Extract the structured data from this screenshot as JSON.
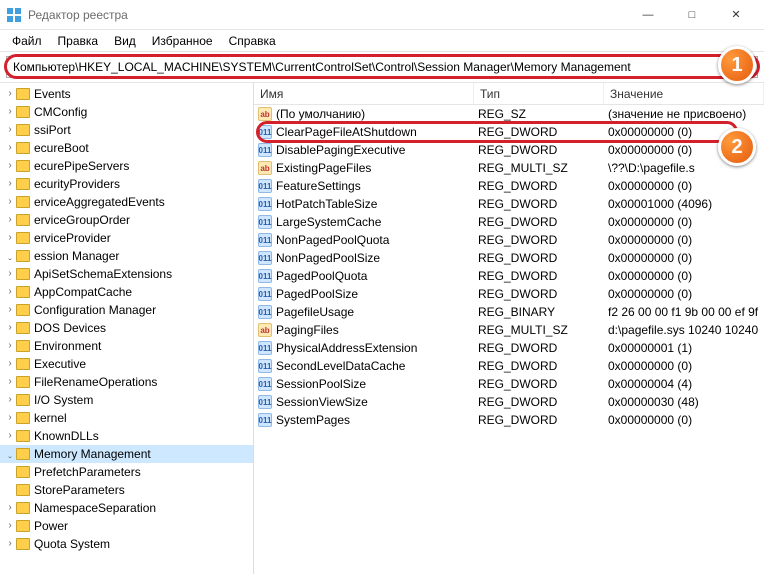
{
  "window": {
    "title": "Редактор реестра",
    "min": "—",
    "max": "□",
    "close": "✕"
  },
  "menu": {
    "file": "Файл",
    "edit": "Правка",
    "view": "Вид",
    "favorites": "Избранное",
    "help": "Справка"
  },
  "address": "Компьютер\\HKEY_LOCAL_MACHINE\\SYSTEM\\CurrentControlSet\\Control\\Session Manager\\Memory Management",
  "columns": {
    "name": "Имя",
    "type": "Тип",
    "value": "Значение"
  },
  "tree": [
    {
      "label": "Events",
      "indent": 1
    },
    {
      "label": "CMConfig",
      "indent": 1
    },
    {
      "label": "ssiPort",
      "indent": 1
    },
    {
      "label": "ecureBoot",
      "indent": 1
    },
    {
      "label": "ecurePipeServers",
      "indent": 1
    },
    {
      "label": "ecurityProviders",
      "indent": 1
    },
    {
      "label": "erviceAggregatedEvents",
      "indent": 1
    },
    {
      "label": "erviceGroupOrder",
      "indent": 1
    },
    {
      "label": "erviceProvider",
      "indent": 1
    },
    {
      "label": "ession Manager",
      "indent": 1,
      "expanded": true
    },
    {
      "label": "ApiSetSchemaExtensions",
      "indent": 2
    },
    {
      "label": "AppCompatCache",
      "indent": 2
    },
    {
      "label": "Configuration Manager",
      "indent": 2
    },
    {
      "label": "DOS Devices",
      "indent": 2
    },
    {
      "label": "Environment",
      "indent": 2
    },
    {
      "label": "Executive",
      "indent": 2
    },
    {
      "label": "FileRenameOperations",
      "indent": 2
    },
    {
      "label": "I/O System",
      "indent": 2
    },
    {
      "label": "kernel",
      "indent": 2
    },
    {
      "label": "KnownDLLs",
      "indent": 2
    },
    {
      "label": "Memory Management",
      "indent": 2,
      "selected": true,
      "expanded": true
    },
    {
      "label": "PrefetchParameters",
      "indent": 3
    },
    {
      "label": "StoreParameters",
      "indent": 3
    },
    {
      "label": "NamespaceSeparation",
      "indent": 2
    },
    {
      "label": "Power",
      "indent": 2
    },
    {
      "label": "Quota System",
      "indent": 2
    }
  ],
  "values": [
    {
      "icon": "str",
      "name": "(По умолчанию)",
      "type": "REG_SZ",
      "value": "(значение не присвоено)"
    },
    {
      "icon": "bin",
      "name": "ClearPageFileAtShutdown",
      "type": "REG_DWORD",
      "value": "0x00000000 (0)",
      "highlighted": true
    },
    {
      "icon": "bin",
      "name": "DisablePagingExecutive",
      "type": "REG_DWORD",
      "value": "0x00000000 (0)"
    },
    {
      "icon": "str",
      "name": "ExistingPageFiles",
      "type": "REG_MULTI_SZ",
      "value": "\\??\\D:\\pagefile.s"
    },
    {
      "icon": "bin",
      "name": "FeatureSettings",
      "type": "REG_DWORD",
      "value": "0x00000000 (0)"
    },
    {
      "icon": "bin",
      "name": "HotPatchTableSize",
      "type": "REG_DWORD",
      "value": "0x00001000 (4096)"
    },
    {
      "icon": "bin",
      "name": "LargeSystemCache",
      "type": "REG_DWORD",
      "value": "0x00000000 (0)"
    },
    {
      "icon": "bin",
      "name": "NonPagedPoolQuota",
      "type": "REG_DWORD",
      "value": "0x00000000 (0)"
    },
    {
      "icon": "bin",
      "name": "NonPagedPoolSize",
      "type": "REG_DWORD",
      "value": "0x00000000 (0)"
    },
    {
      "icon": "bin",
      "name": "PagedPoolQuota",
      "type": "REG_DWORD",
      "value": "0x00000000 (0)"
    },
    {
      "icon": "bin",
      "name": "PagedPoolSize",
      "type": "REG_DWORD",
      "value": "0x00000000 (0)"
    },
    {
      "icon": "bin",
      "name": "PagefileUsage",
      "type": "REG_BINARY",
      "value": "f2 26 00 00 f1 9b 00 00 ef 9f"
    },
    {
      "icon": "str",
      "name": "PagingFiles",
      "type": "REG_MULTI_SZ",
      "value": "d:\\pagefile.sys 10240 10240"
    },
    {
      "icon": "bin",
      "name": "PhysicalAddressExtension",
      "type": "REG_DWORD",
      "value": "0x00000001 (1)"
    },
    {
      "icon": "bin",
      "name": "SecondLevelDataCache",
      "type": "REG_DWORD",
      "value": "0x00000000 (0)"
    },
    {
      "icon": "bin",
      "name": "SessionPoolSize",
      "type": "REG_DWORD",
      "value": "0x00000004 (4)"
    },
    {
      "icon": "bin",
      "name": "SessionViewSize",
      "type": "REG_DWORD",
      "value": "0x00000030 (48)"
    },
    {
      "icon": "bin",
      "name": "SystemPages",
      "type": "REG_DWORD",
      "value": "0x00000000 (0)"
    }
  ],
  "callouts": {
    "one": "1",
    "two": "2"
  }
}
